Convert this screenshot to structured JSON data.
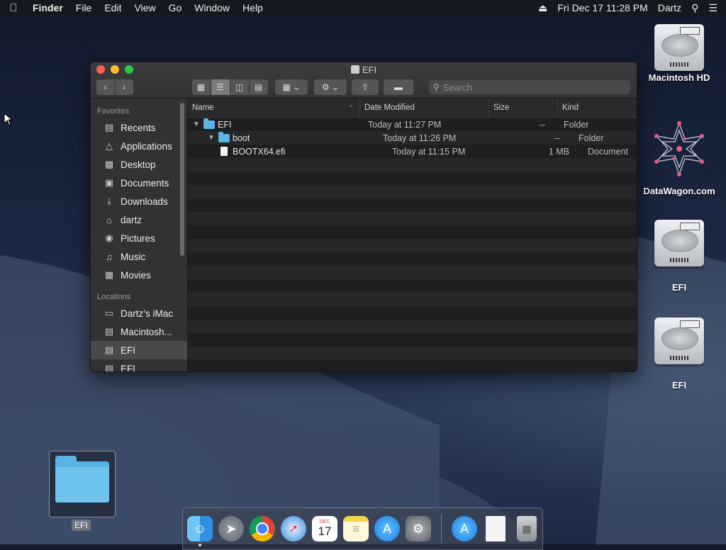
{
  "menubar": {
    "app": "Finder",
    "items": [
      "File",
      "Edit",
      "View",
      "Go",
      "Window",
      "Help"
    ],
    "datetime": "Fri Dec 17  11:28 PM",
    "user": "Dartz"
  },
  "desktop_icons": [
    {
      "label": "Macintosh HD"
    },
    {
      "label": "DataWagon.com"
    },
    {
      "label": "EFI"
    },
    {
      "label": "EFI"
    }
  ],
  "window": {
    "title": "EFI",
    "search_placeholder": "Search",
    "columns": {
      "name": "Name",
      "date": "Date Modified",
      "size": "Size",
      "kind": "Kind"
    },
    "files": [
      {
        "name": "EFI",
        "date": "Today at 11:27 PM",
        "size": "--",
        "kind": "Folder"
      },
      {
        "name": "boot",
        "date": "Today at 11:26 PM",
        "size": "--",
        "kind": "Folder"
      },
      {
        "name": "BOOTX64.efi",
        "date": "Today at 11:15 PM",
        "size": "1 MB",
        "kind": "Document"
      }
    ]
  },
  "sidebar": {
    "favorites_heading": "Favorites",
    "favorites": [
      {
        "label": "Recents",
        "icon": "recents-icon"
      },
      {
        "label": "Applications",
        "icon": "applications-icon"
      },
      {
        "label": "Desktop",
        "icon": "desktop-icon"
      },
      {
        "label": "Documents",
        "icon": "documents-icon"
      },
      {
        "label": "Downloads",
        "icon": "downloads-icon"
      },
      {
        "label": "dartz",
        "icon": "home-icon"
      },
      {
        "label": "Pictures",
        "icon": "pictures-icon"
      },
      {
        "label": "Music",
        "icon": "music-icon"
      },
      {
        "label": "Movies",
        "icon": "movies-icon"
      }
    ],
    "locations_heading": "Locations",
    "locations": [
      {
        "label": "Dartz’s iMac",
        "icon": "computer-icon"
      },
      {
        "label": "Macintosh...",
        "icon": "disk-icon"
      },
      {
        "label": "EFI",
        "icon": "disk-icon"
      },
      {
        "label": "EFI",
        "icon": "disk-icon"
      }
    ]
  },
  "desktop_folder": {
    "label": "EFI"
  },
  "dock": {
    "apps": [
      "finder-icon",
      "launchpad-icon",
      "chrome-icon",
      "safari-icon",
      "calendar-icon",
      "notes-icon",
      "app-store-icon",
      "system-preferences-icon",
      "app-store-icon",
      "document-icon",
      "trash-icon"
    ],
    "calendar_month": "DEC",
    "calendar_day": "17"
  },
  "colors": {
    "accent_folder": "#5bb5e6",
    "close": "#fe5f57",
    "minimize": "#febc2e",
    "maximize": "#28c840"
  }
}
